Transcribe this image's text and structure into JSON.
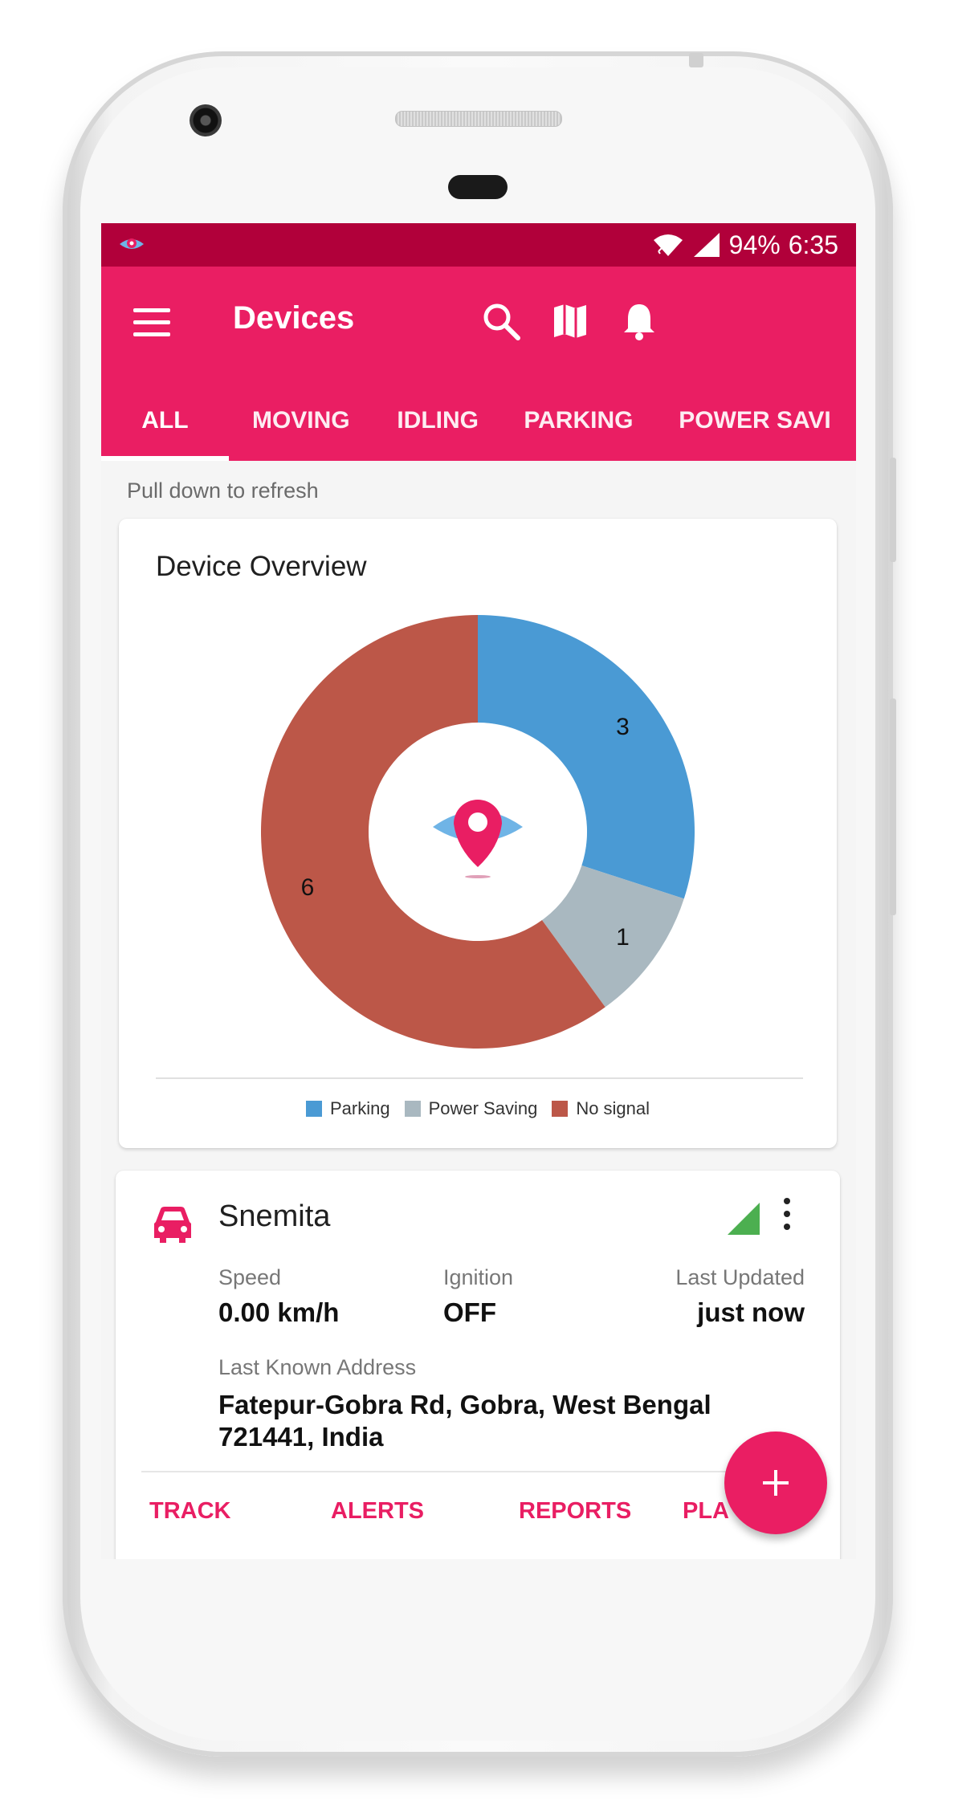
{
  "statusbar": {
    "battery": "94%",
    "time": "6:35"
  },
  "appbar": {
    "title": "Devices",
    "icons": [
      "menu-icon",
      "search-icon",
      "map-icon",
      "bell-icon"
    ]
  },
  "tabs": [
    {
      "label": "ALL",
      "active": true
    },
    {
      "label": "MOVING",
      "active": false
    },
    {
      "label": "IDLING",
      "active": false
    },
    {
      "label": "PARKING",
      "active": false
    },
    {
      "label": "POWER SAVI",
      "active": false
    }
  ],
  "hint": "Pull down to refresh",
  "overview": {
    "title": "Device Overview",
    "chart_data": {
      "type": "pie",
      "donut": true,
      "categories": [
        "Parking",
        "Power Saving",
        "No signal"
      ],
      "values": [
        3,
        1,
        6
      ],
      "colors": [
        "#4a9ad4",
        "#a9b8c0",
        "#bc5748"
      ],
      "legend": "bottom",
      "center_icon": "eye-pin-logo-icon"
    }
  },
  "device": {
    "name": "Snemita",
    "speed_label": "Speed",
    "speed_value": "0.00 km/h",
    "ignition_label": "Ignition",
    "ignition_value": "OFF",
    "updated_label": "Last Updated",
    "updated_value": "just now",
    "address_label": "Last Known Address",
    "address_value": "Fatepur-Gobra Rd, Gobra, West Bengal 721441, India",
    "actions": [
      "TRACK",
      "ALERTS",
      "REPORTS",
      "PLA"
    ]
  },
  "fab": {
    "label": "+"
  },
  "colors": {
    "primary": "#ea1e63",
    "primary_dark": "#b1003a",
    "signal_green": "#4caf50"
  }
}
